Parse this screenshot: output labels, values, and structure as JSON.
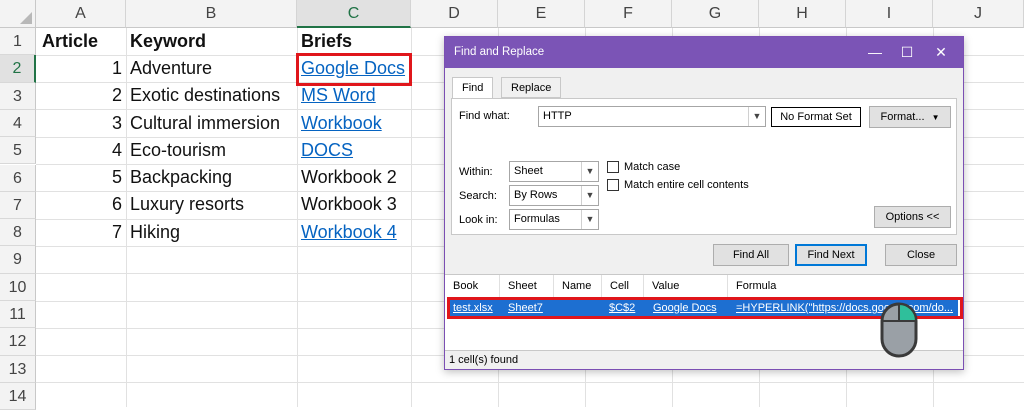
{
  "columns": [
    "A",
    "B",
    "C",
    "D",
    "E",
    "F",
    "G",
    "H",
    "I",
    "J"
  ],
  "selected_column": "C",
  "rows": [
    "1",
    "2",
    "3",
    "4",
    "5",
    "6",
    "7",
    "8",
    "9",
    "10",
    "11",
    "12",
    "13",
    "14"
  ],
  "selected_row": "2",
  "headers": {
    "a": "Article",
    "b": "Keyword",
    "c": "Briefs"
  },
  "data_rows": [
    {
      "article": "1",
      "keyword": "Adventure",
      "brief": "Google Docs",
      "link": true
    },
    {
      "article": "2",
      "keyword": "Exotic destinations",
      "brief": "MS Word",
      "link": true
    },
    {
      "article": "3",
      "keyword": "Cultural immersion",
      "brief": "Workbook",
      "link": true
    },
    {
      "article": "4",
      "keyword": "Eco-tourism",
      "brief": "DOCS",
      "link": true
    },
    {
      "article": "5",
      "keyword": "Backpacking",
      "brief": "Workbook 2",
      "link": false
    },
    {
      "article": "6",
      "keyword": "Luxury resorts",
      "brief": "Workbook 3",
      "link": false
    },
    {
      "article": "7",
      "keyword": "Hiking",
      "brief": "Workbook 4",
      "link": true
    }
  ],
  "dialog": {
    "title": "Find and Replace",
    "minimize_icon": "—",
    "maximize_icon": "☐",
    "close_icon": "✕",
    "tabs": {
      "find": "Find",
      "replace": "Replace"
    },
    "find_what_label": "Find what:",
    "find_what_value": "HTTP",
    "no_format": "No Format Set",
    "format_button": "Format...",
    "within_label": "Within:",
    "within_value": "Sheet",
    "search_label": "Search:",
    "search_value": "By Rows",
    "lookin_label": "Look in:",
    "lookin_value": "Formulas",
    "match_case": "Match case",
    "match_entire": "Match entire cell contents",
    "options_button": "Options <<",
    "find_all": "Find All",
    "find_next": "Find Next",
    "close_button": "Close",
    "result_headers": [
      "Book",
      "Sheet",
      "Name",
      "Cell",
      "Value",
      "Formula"
    ],
    "result_row": {
      "book": "test.xlsx",
      "sheet": "Sheet7",
      "name": "",
      "cell": "$C$2",
      "value": "Google Docs",
      "formula": "=HYPERLINK(\"https://docs.google.com/do..."
    },
    "status": "1 cell(s) found"
  },
  "colors": {
    "accent": "#7b54b6",
    "highlight": "#e0161b",
    "link": "#0563c1",
    "selection": "#1d6fd1"
  }
}
